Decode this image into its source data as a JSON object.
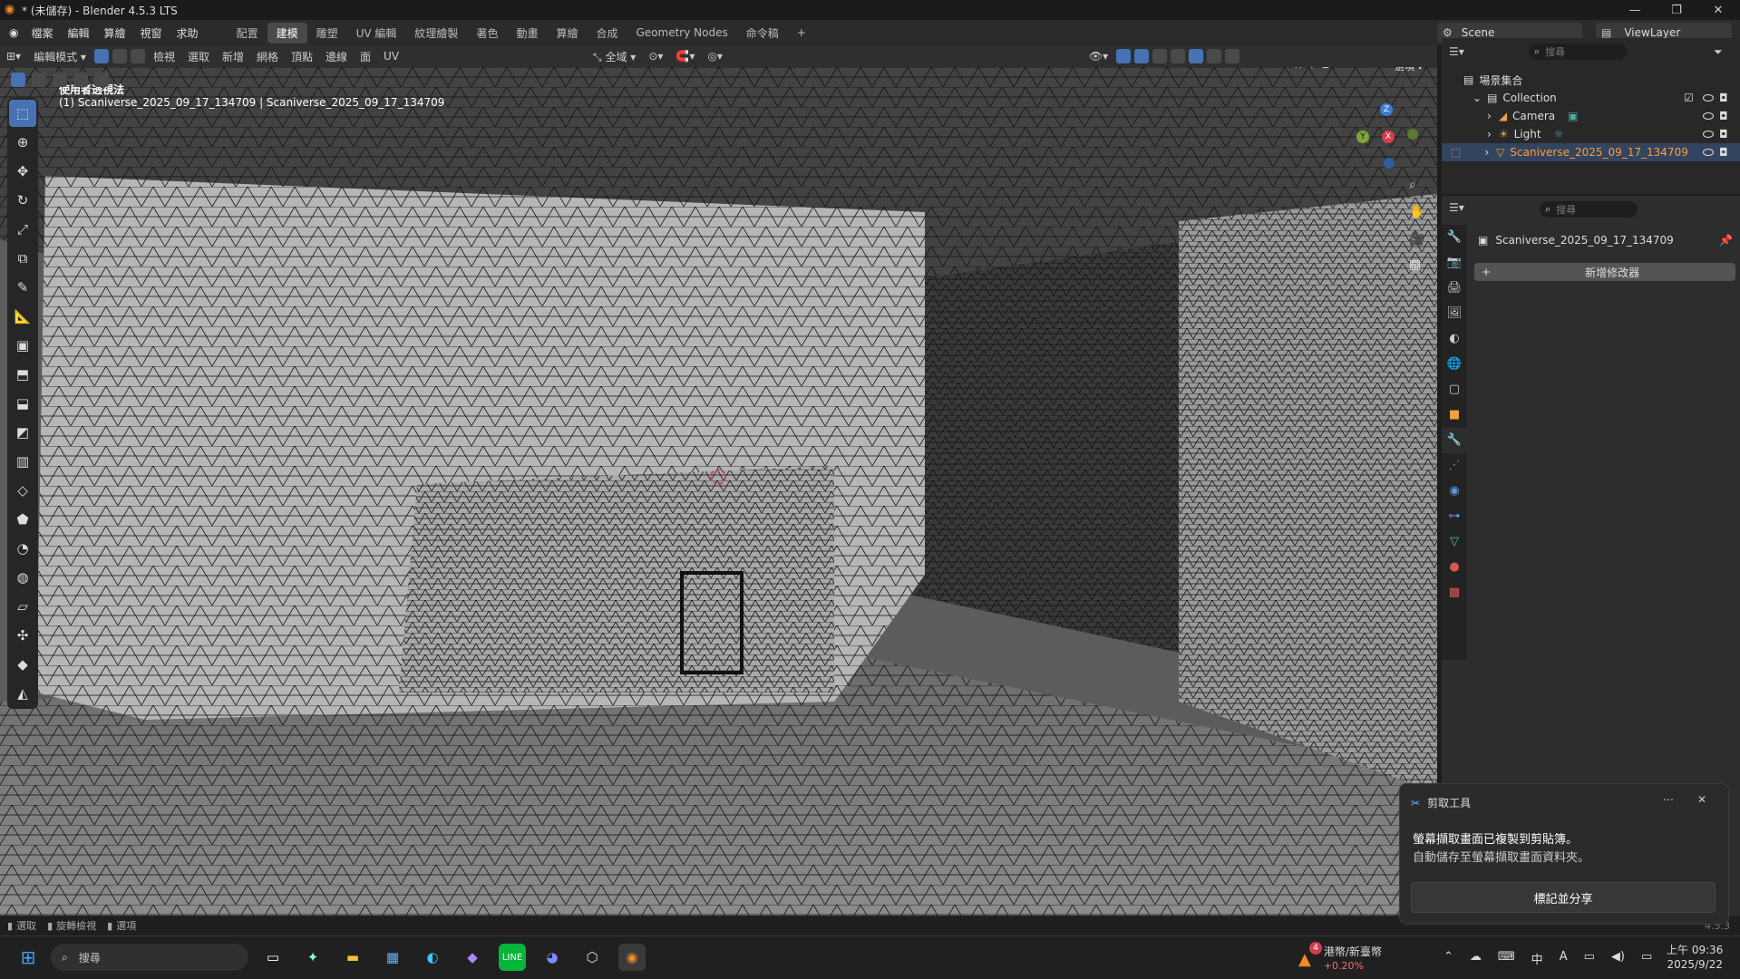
{
  "window": {
    "title": "* (未儲存) - Blender 4.5.3 LTS"
  },
  "menus": [
    "檔案",
    "編輯",
    "算繪",
    "視窗",
    "求助"
  ],
  "workspaces": [
    {
      "label": "配置",
      "active": false
    },
    {
      "label": "建模",
      "active": true
    },
    {
      "label": "雕塑",
      "active": false
    },
    {
      "label": "UV 編輯",
      "active": false
    },
    {
      "label": "紋理繪製",
      "active": false
    },
    {
      "label": "著色",
      "active": false
    },
    {
      "label": "動畫",
      "active": false
    },
    {
      "label": "算繪",
      "active": false
    },
    {
      "label": "合成",
      "active": false
    },
    {
      "label": "Geometry Nodes",
      "active": false
    },
    {
      "label": "命令稿",
      "active": false
    }
  ],
  "scene": {
    "label": "Scene"
  },
  "viewlayer": {
    "label": "ViewLayer"
  },
  "header3d": {
    "mode": "編輯模式",
    "menus": [
      "檢視",
      "選取",
      "新增",
      "網格",
      "頂點",
      "邊線",
      "面",
      "UV"
    ],
    "transform_orientation": "全域",
    "options_label": "選項",
    "axes": [
      "X",
      "Y",
      "Z"
    ]
  },
  "viewport": {
    "view_name": "使用者透視法",
    "object_line": "(1) Scaniverse_2025_09_17_134709 | Scaniverse_2025_09_17_134709",
    "gizmo": {
      "x": "X",
      "y": "Y",
      "z": "Z"
    }
  },
  "outliner": {
    "search_placeholder": "搜尋",
    "scene_collection": "場景集合",
    "items": [
      {
        "label": "Collection"
      },
      {
        "label": "Camera"
      },
      {
        "label": "Light"
      },
      {
        "label": "Scaniverse_2025_09_17_134709"
      }
    ]
  },
  "properties": {
    "search_placeholder": "搜尋",
    "object_name": "Scaniverse_2025_09_17_134709",
    "add_modifier": "新增修改器"
  },
  "statusbar": {
    "items": [
      "選取",
      "旋轉檢視",
      "選項"
    ],
    "version": "4.5.3"
  },
  "toast": {
    "app": "剪取工具",
    "line1": "螢幕擷取畫面已複製到剪貼簿。",
    "line2": "自動儲存至螢幕擷取畫面資料夾。",
    "button": "標記並分享"
  },
  "taskbar": {
    "search": "搜尋",
    "stock_name": "港幣/新臺幣",
    "stock_change": "+0.20%",
    "stock_badge": "4",
    "time": "上午 09:36",
    "date": "2025/9/22",
    "ime": "A"
  },
  "colors": {
    "accent": "#4772b3",
    "selected_text": "#ff9d3d",
    "x_axis": "#d13e50",
    "y_axis": "#7ea43a",
    "z_axis": "#3f7dd1"
  }
}
